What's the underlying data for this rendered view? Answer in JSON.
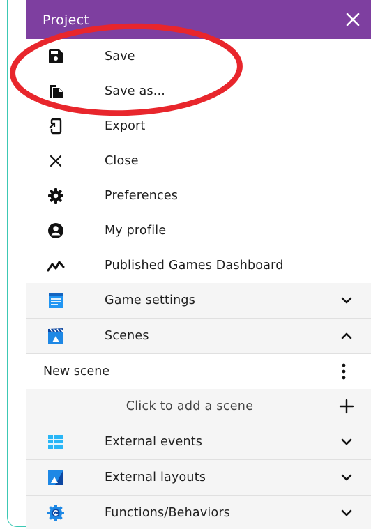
{
  "window": {
    "title": "Project"
  },
  "menu": [
    {
      "label": "Save",
      "icon": "save-icon"
    },
    {
      "label": "Save as...",
      "icon": "save-as-icon"
    },
    {
      "label": "Export",
      "icon": "export-icon"
    },
    {
      "label": "Close",
      "icon": "close-icon"
    },
    {
      "label": "Preferences",
      "icon": "gear-icon"
    },
    {
      "label": "My profile",
      "icon": "account-icon"
    },
    {
      "label": "Published Games Dashboard",
      "icon": "analytics-icon"
    }
  ],
  "sections": {
    "game_settings": {
      "label": "Game settings",
      "icon": "game-settings-icon",
      "state": "collapsed"
    },
    "scenes": {
      "label": "Scenes",
      "icon": "scenes-icon",
      "state": "expanded",
      "items": [
        {
          "label": "New scene"
        }
      ],
      "add_label": "Click to add a scene"
    },
    "external_events": {
      "label": "External events",
      "icon": "external-events-icon",
      "state": "collapsed"
    },
    "external_layouts": {
      "label": "External layouts",
      "icon": "external-layouts-icon",
      "state": "collapsed"
    },
    "functions_behaviors": {
      "label": "Functions/Behaviors",
      "icon": "functions-icon",
      "state": "collapsed"
    }
  },
  "colors": {
    "titlebar": "#7e3fa0",
    "annotation": "#e8262c",
    "frame": "#3cc8b4",
    "section_bg": "#f5f5f5"
  }
}
